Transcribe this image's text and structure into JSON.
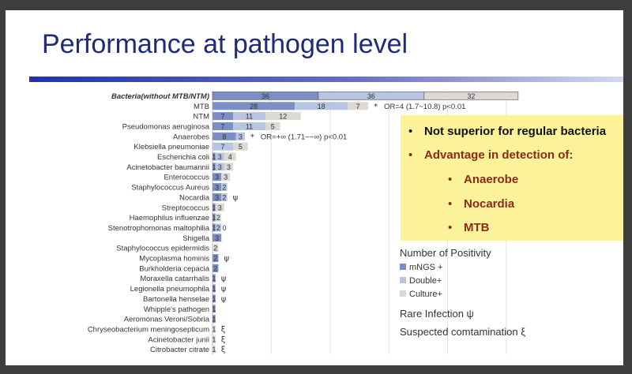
{
  "slide": {
    "title": "Performance at pathogen level"
  },
  "chart_data": {
    "type": "bar",
    "stacked": true,
    "orientation": "horizontal",
    "categories": [
      "Bacteria(without MTB/NTM)",
      "MTB",
      "NTM",
      "Pseudomonas aeruginosa",
      "Anaerobes",
      "Klebsiella pneumoniae",
      "Escherichia coli",
      "Acinetobacter baumannii",
      "Enterococcus",
      "Staphylococcus Aureus",
      "Nocardia",
      "Streptococcus",
      "Haemophilus influenzae",
      "Stenotrophomonas maltophilia",
      "Shigella",
      "Staphylococcus epidermidis",
      "Mycoplasma hominis",
      "Burkholderia cepacia",
      "Moraxella catarrhalis",
      "Legionella pneumophila",
      "Bartonella henselae",
      "Whipple's pathogen",
      "Aeromonas Veroni/Sobria",
      "Chryseobacterium meningosepticum",
      "Acinetobacter junii",
      "Citrobacter citrate"
    ],
    "series": [
      {
        "name": "mNGS +",
        "color": "#7b8fc4",
        "values": [
          36,
          28,
          7,
          7,
          8,
          0,
          1,
          1,
          3,
          3,
          3,
          1,
          1,
          1,
          3,
          0,
          2,
          2,
          1,
          1,
          1,
          1,
          1,
          0,
          0,
          0
        ]
      },
      {
        "name": "Double+",
        "color": "#b7c5e1",
        "values": [
          36,
          18,
          11,
          11,
          3,
          7,
          3,
          3,
          0,
          2,
          2,
          0,
          0,
          2,
          0,
          0,
          0,
          0,
          0,
          0,
          0,
          0,
          0,
          0,
          0,
          0
        ]
      },
      {
        "name": "Culture+",
        "color": "#dcd8d3",
        "values": [
          32,
          7,
          12,
          5,
          0,
          5,
          4,
          3,
          3,
          0,
          0,
          3,
          2,
          0,
          0,
          2,
          0,
          0,
          0,
          0,
          0,
          0,
          0,
          1,
          1,
          1
        ]
      }
    ],
    "labels": [
      [
        "36",
        "36",
        "32"
      ],
      [
        "28",
        "18",
        "7"
      ],
      [
        "7",
        "11",
        "12"
      ],
      [
        "7",
        "11",
        "5"
      ],
      [
        "8",
        "3",
        ""
      ],
      [
        "",
        "7",
        "5"
      ],
      [
        "1",
        "3",
        "4"
      ],
      [
        "1",
        "3",
        "3"
      ],
      [
        "3",
        "",
        "3"
      ],
      [
        "3",
        "2",
        ""
      ],
      [
        "3",
        "2",
        ""
      ],
      [
        "1",
        "",
        "3"
      ],
      [
        "1",
        "",
        "2"
      ],
      [
        "1",
        "2",
        "0"
      ],
      [
        "3",
        "",
        ""
      ],
      [
        "",
        "",
        "2"
      ],
      [
        "2",
        "",
        ""
      ],
      [
        "2",
        "",
        ""
      ],
      [
        "1",
        "",
        ""
      ],
      [
        "1",
        "",
        ""
      ],
      [
        "1",
        "",
        ""
      ],
      [
        "1",
        "",
        ""
      ],
      [
        "1",
        "",
        ""
      ],
      [
        "",
        "",
        "1"
      ],
      [
        "",
        "",
        "1"
      ],
      [
        "",
        "",
        "1"
      ]
    ],
    "markers": [
      "",
      "*",
      "",
      "",
      "*",
      "",
      "",
      "",
      "",
      "",
      "ψ",
      "",
      "",
      "",
      "",
      "",
      "ψ",
      "",
      "ψ",
      "ψ",
      "ψ",
      "",
      "",
      "ξ",
      "ξ",
      "ξ"
    ],
    "annotations": [
      {
        "category": "MTB",
        "text": "OR=4 (1.7~10.8) p<0.01"
      },
      {
        "category": "Anaerobes",
        "text": "OR=+∞ (1.71~~∞) p<0.01"
      }
    ],
    "xlim": [
      0,
      104
    ],
    "grid": true
  },
  "callout": {
    "items": [
      {
        "bullet": "•",
        "text": "Not superior for regular bacteria",
        "color": "#111111"
      },
      {
        "bullet": "•",
        "text": "Advantage in detection of:",
        "color": "#8a2a1a"
      },
      {
        "bullet": "•",
        "text": "Anaerobe",
        "color": "#8a2a1a"
      },
      {
        "bullet": "•",
        "text": "Nocardia",
        "color": "#8a2a1a"
      },
      {
        "bullet": "•",
        "text": "MTB",
        "color": "#8a2a1a"
      }
    ]
  },
  "legend": {
    "heading": "Number of Positivity",
    "items": [
      {
        "label": "mNGS +",
        "color": "#7b8fc4"
      },
      {
        "label": "Double+",
        "color": "#b7c5e1"
      },
      {
        "label": "Culture+",
        "color": "#dcd8d3"
      }
    ],
    "notes": [
      "Rare Infection ψ",
      "Suspected comtamination ξ"
    ]
  }
}
